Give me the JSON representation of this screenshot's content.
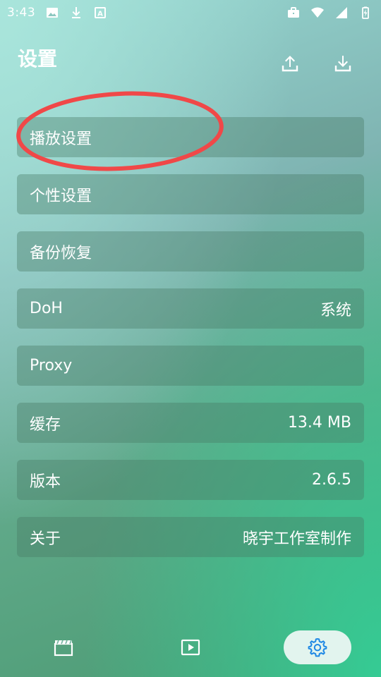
{
  "status_bar": {
    "time": "3:43",
    "left_icons": [
      "image-icon",
      "download-icon",
      "text-a-icon"
    ],
    "right_icons": [
      "briefcase-icon",
      "wifi-icon",
      "signal-icon",
      "battery-charging-icon"
    ]
  },
  "header": {
    "title": "设置",
    "upload_icon": "upload-icon",
    "download_icon": "download-icon"
  },
  "settings": [
    {
      "label": "播放设置",
      "value": ""
    },
    {
      "label": "个性设置",
      "value": ""
    },
    {
      "label": "备份恢复",
      "value": ""
    },
    {
      "label": "DoH",
      "value": "系统"
    },
    {
      "label": "Proxy",
      "value": ""
    },
    {
      "label": "缓存",
      "value": "13.4 MB"
    },
    {
      "label": "版本",
      "value": "2.6.5"
    },
    {
      "label": "关于",
      "value": "晓宇工作室制作"
    }
  ],
  "annotation": {
    "shape": "ellipse",
    "color": "#f04848",
    "target": "播放设置"
  },
  "bottom_nav": {
    "items": [
      "clapperboard-icon",
      "play-icon",
      "gear-icon"
    ],
    "active": "gear-icon",
    "active_color": "#1e88e5"
  }
}
